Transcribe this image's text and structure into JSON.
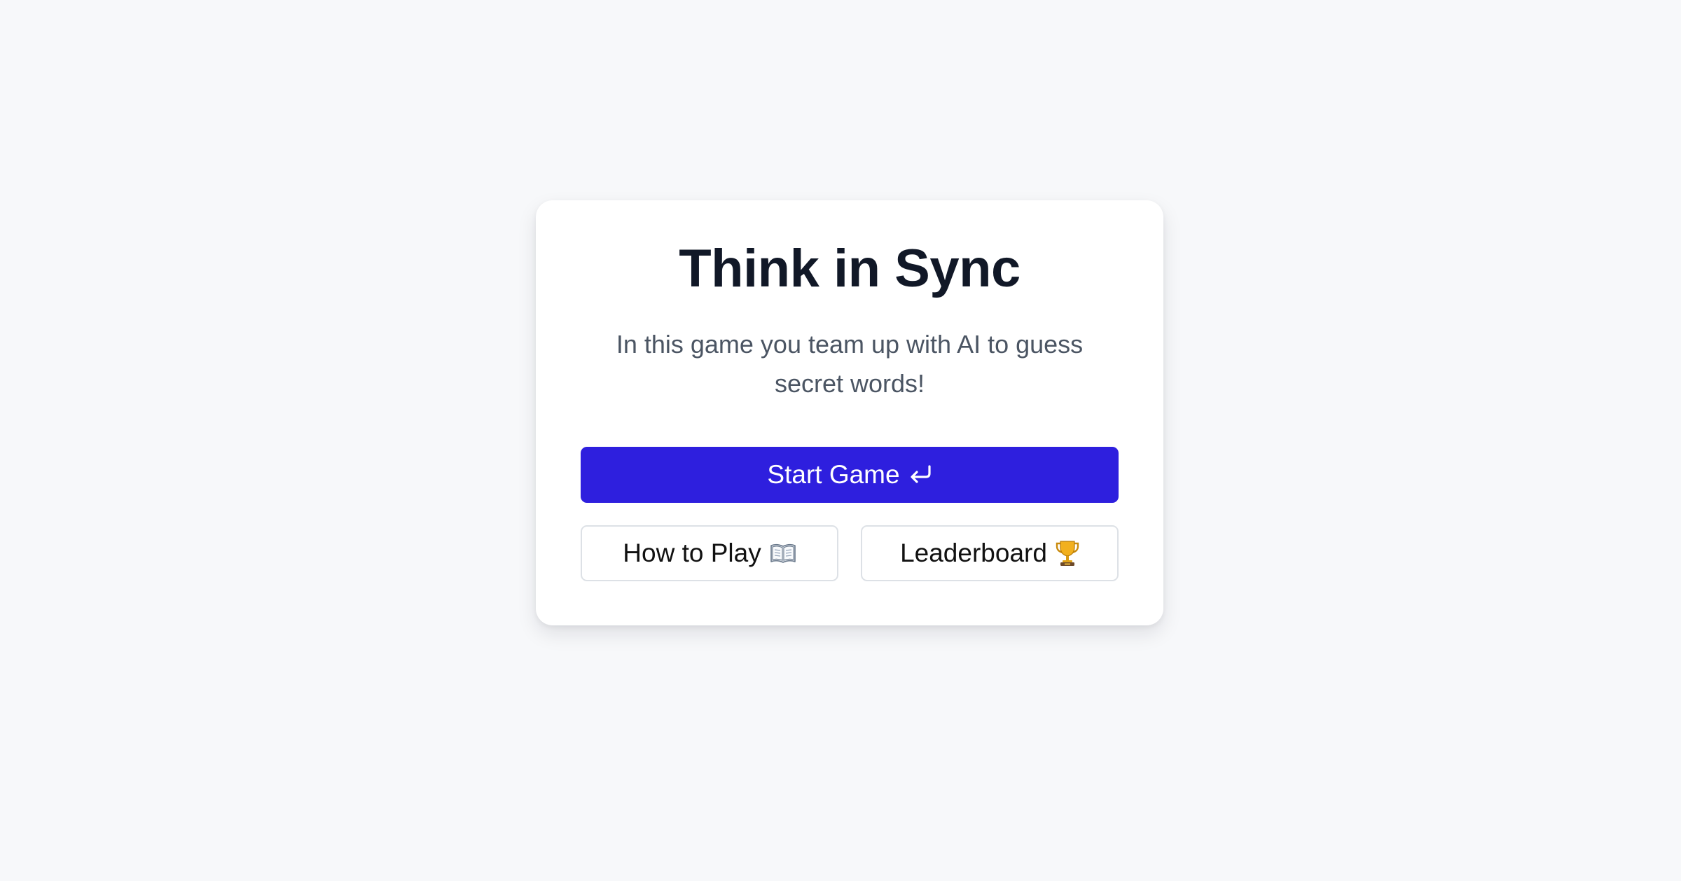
{
  "card": {
    "title": "Think in Sync",
    "subtitle": "In this game you team up with AI to guess secret words!"
  },
  "buttons": {
    "start": {
      "label": "Start Game",
      "icon": "enter-return-icon"
    },
    "how_to_play": {
      "label": "How to Play",
      "icon": "open-book-icon"
    },
    "leaderboard": {
      "label": "Leaderboard",
      "icon": "trophy-icon"
    }
  },
  "colors": {
    "primary": "#2e1fde",
    "title": "#111827",
    "subtitle": "#4b5563",
    "background": "#f7f8fa"
  }
}
